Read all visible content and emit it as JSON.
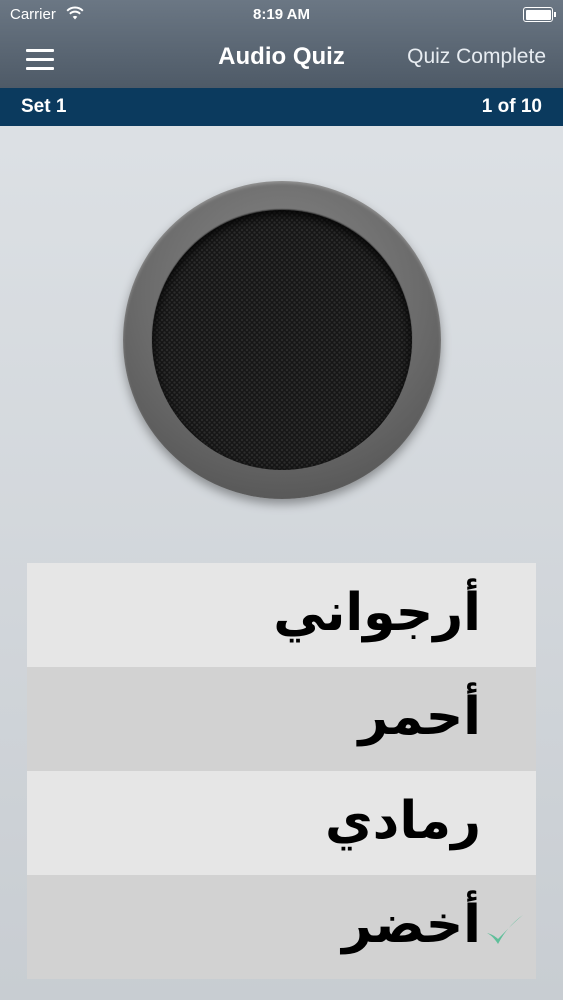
{
  "status_bar": {
    "carrier": "Carrier",
    "time": "8:19 AM",
    "wifi_icon": "wifi-icon",
    "battery_icon": "battery-icon",
    "battery_level": 1.0
  },
  "nav": {
    "menu_icon": "hamburger-menu-icon",
    "title": "Audio Quiz",
    "right_button": "Quiz Complete"
  },
  "set_bar": {
    "set_name": "Set 1",
    "progress": "1 of 10"
  },
  "speaker": {
    "icon": "speaker-icon"
  },
  "answers": [
    {
      "text": "أرجواني",
      "correct": false
    },
    {
      "text": "أحمر",
      "correct": false
    },
    {
      "text": "رمادي",
      "correct": false
    },
    {
      "text": "أخضر",
      "correct": true
    }
  ],
  "colors": {
    "nav_background": "#5d6976",
    "set_bar_background": "#0b3a5e",
    "checkmark": "#5fbf9a"
  }
}
